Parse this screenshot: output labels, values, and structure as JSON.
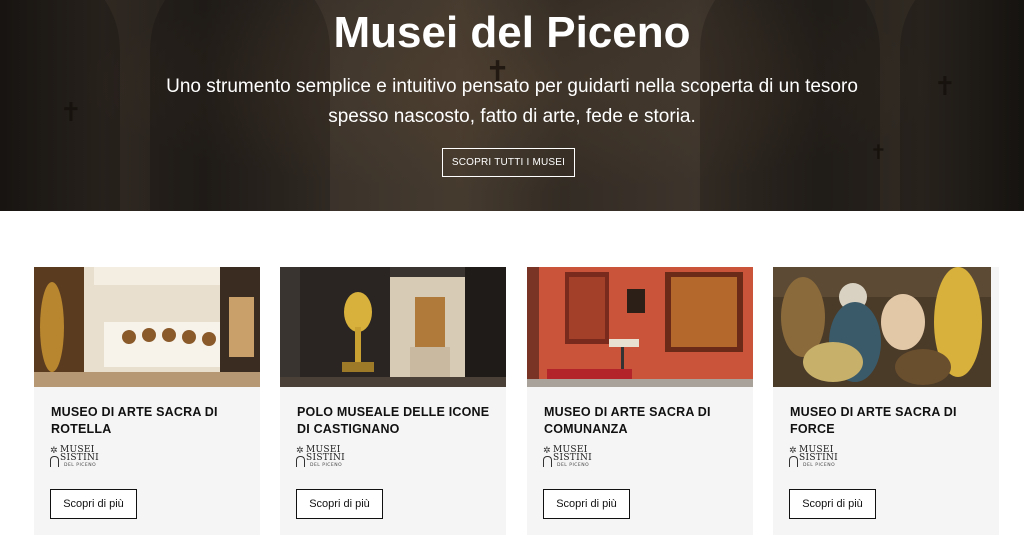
{
  "hero": {
    "title": "Musei del Piceno",
    "subtitle": "Uno strumento semplice e intuitivo pensato per guidarti nella scoperta di un tesoro spesso nascosto, fatto di arte, fede e storia.",
    "button_label": "SCOPRI TUTTI I MUSEI"
  },
  "cards": [
    {
      "title": "MUSEO DI ARTE SACRA DI ROTELLA",
      "logo_line1": "MUSEI",
      "logo_line2": "SISTINI",
      "logo_line3": "DEL PICENO",
      "button_label": "Scopri di più"
    },
    {
      "title": "POLO MUSEALE DELLE ICONE DI CASTIGNANO",
      "logo_line1": "MUSEI",
      "logo_line2": "SISTINI",
      "logo_line3": "DEL PICENO",
      "button_label": "Scopri di più"
    },
    {
      "title": "MUSEO DI ARTE SACRA DI COMUNANZA",
      "logo_line1": "MUSEI",
      "logo_line2": "SISTINI",
      "logo_line3": "DEL PICENO",
      "button_label": "Scopri di più"
    },
    {
      "title": "MUSEO DI ARTE SACRA DI FORCE",
      "logo_line1": "MUSEI",
      "logo_line2": "SISTINI",
      "logo_line3": "DEL PICENO",
      "button_label": "Scopri di più"
    }
  ],
  "colors": {
    "hero_text": "#ffffff",
    "card_bg": "#f5f5f5",
    "button_border": "#111111"
  }
}
